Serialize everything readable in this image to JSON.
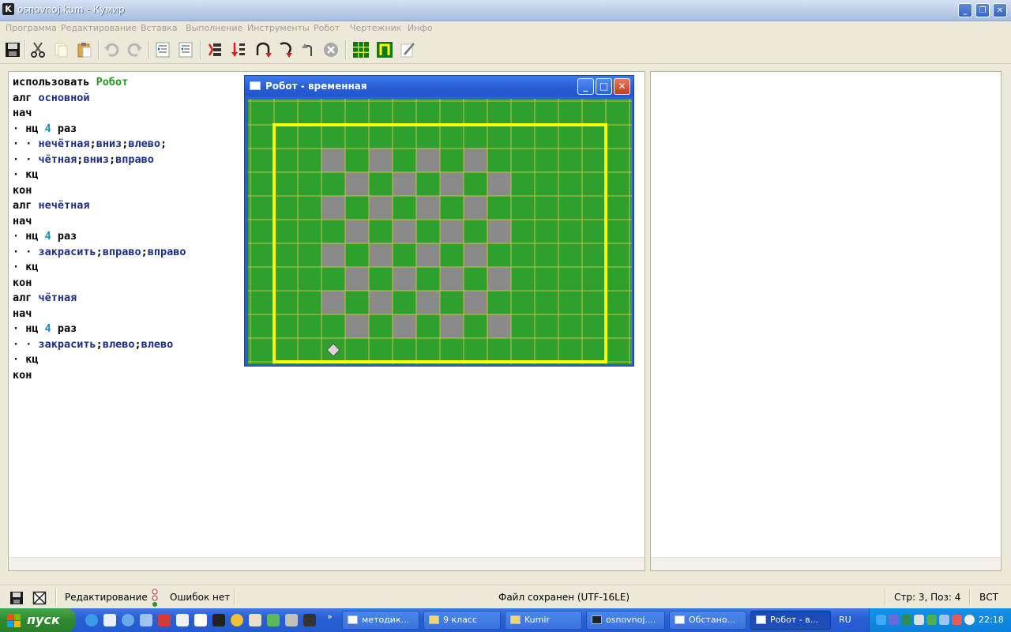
{
  "window": {
    "title": "osnovnoj.kum - Кумир",
    "icon_letter": "K"
  },
  "menu": [
    "Программа",
    "Редактирование",
    "Вставка",
    "Выполнение",
    "Инструменты",
    "Робот",
    "Чертежник",
    "Инфо"
  ],
  "toolbar": [
    "save-icon",
    "cut-icon",
    "copy-icon",
    "paste-icon",
    "undo-icon",
    "redo-icon",
    "indent-icon",
    "outdent-icon",
    "run-icon",
    "step-icon",
    "step-into-icon",
    "step-out-icon",
    "step-back-icon",
    "stop-icon",
    "robot-field-icon",
    "drawer-icon",
    "edit-icon"
  ],
  "code": [
    [
      [
        "kw",
        "использовать "
      ],
      [
        "grn",
        "Робот"
      ]
    ],
    [
      [
        "kw",
        "алг "
      ],
      [
        "nm",
        "основной"
      ]
    ],
    [
      [
        "kw",
        "нач"
      ]
    ],
    [
      [
        "kw",
        "· нц "
      ],
      [
        "num",
        "4"
      ],
      [
        "kw",
        " раз"
      ]
    ],
    [
      [
        "kw",
        "· · "
      ],
      [
        "nm",
        "нечётная"
      ],
      [
        "kw",
        ";"
      ],
      [
        "nm",
        "вниз"
      ],
      [
        "kw",
        ";"
      ],
      [
        "nm",
        "влево"
      ],
      [
        "kw",
        ";"
      ]
    ],
    [
      [
        "kw",
        "· · "
      ],
      [
        "nm",
        "чётная"
      ],
      [
        "kw",
        ";"
      ],
      [
        "nm",
        "вниз"
      ],
      [
        "kw",
        ";"
      ],
      [
        "nm",
        "вправо"
      ]
    ],
    [
      [
        "kw",
        "· кц"
      ]
    ],
    [
      [
        "kw",
        "кон"
      ]
    ],
    [
      [
        "kw",
        "алг "
      ],
      [
        "nm",
        "нечётная"
      ]
    ],
    [
      [
        "kw",
        "нач"
      ]
    ],
    [
      [
        "kw",
        "· нц "
      ],
      [
        "num",
        "4"
      ],
      [
        "kw",
        " раз"
      ]
    ],
    [
      [
        "kw",
        "· · "
      ],
      [
        "nm",
        "закрасить"
      ],
      [
        "kw",
        ";"
      ],
      [
        "nm",
        "вправо"
      ],
      [
        "kw",
        ";"
      ],
      [
        "nm",
        "вправо"
      ]
    ],
    [
      [
        "kw",
        "· кц"
      ]
    ],
    [
      [
        "kw",
        "кон"
      ]
    ],
    [
      [
        "kw",
        "алг "
      ],
      [
        "nm",
        "чётная"
      ]
    ],
    [
      [
        "kw",
        "нач"
      ]
    ],
    [
      [
        "kw",
        "· нц "
      ],
      [
        "num",
        "4"
      ],
      [
        "kw",
        " раз"
      ]
    ],
    [
      [
        "kw",
        "· · "
      ],
      [
        "nm",
        "закрасить"
      ],
      [
        "kw",
        ";"
      ],
      [
        "nm",
        "влево"
      ],
      [
        "kw",
        ";"
      ],
      [
        "nm",
        "влево"
      ]
    ],
    [
      [
        "kw",
        "· кц"
      ]
    ],
    [
      [
        "kw",
        "кон"
      ]
    ]
  ],
  "robot_window": {
    "title": "Робот - временная",
    "grid": {
      "cols": 16,
      "rows": 11
    },
    "wall_rect": {
      "col_start": 1,
      "row_start": 1,
      "col_end": 15,
      "row_end": 11
    },
    "painted_cells": [
      [
        3,
        2
      ],
      [
        5,
        2
      ],
      [
        7,
        2
      ],
      [
        9,
        2
      ],
      [
        4,
        3
      ],
      [
        6,
        3
      ],
      [
        8,
        3
      ],
      [
        10,
        3
      ],
      [
        3,
        4
      ],
      [
        5,
        4
      ],
      [
        7,
        4
      ],
      [
        9,
        4
      ],
      [
        4,
        5
      ],
      [
        6,
        5
      ],
      [
        8,
        5
      ],
      [
        10,
        5
      ],
      [
        3,
        6
      ],
      [
        5,
        6
      ],
      [
        7,
        6
      ],
      [
        9,
        6
      ],
      [
        4,
        7
      ],
      [
        6,
        7
      ],
      [
        8,
        7
      ],
      [
        10,
        7
      ],
      [
        3,
        8
      ],
      [
        5,
        8
      ],
      [
        7,
        8
      ],
      [
        9,
        8
      ],
      [
        4,
        9
      ],
      [
        6,
        9
      ],
      [
        8,
        9
      ],
      [
        10,
        9
      ]
    ],
    "robot": [
      3,
      10
    ],
    "colors": {
      "field": "#2ea02e",
      "grid": "#c8c040",
      "wall": "#ffff00",
      "paint": "#8a8a8a",
      "robot": "#d8d8d8"
    }
  },
  "status": {
    "mode": "Редактирование",
    "errors": "Ошибок нет",
    "file": "Файл сохранен (UTF-16LE)",
    "position": "Стр: 3, Поз: 4",
    "insert": "ВСТ"
  },
  "taskbar": {
    "start": "пуск",
    "tasks": [
      "методик...",
      "9 класс",
      "Kumir",
      "osnovnoj....",
      "Обстано...",
      "Робот - в..."
    ],
    "lang": "RU",
    "clock": "22:18"
  }
}
